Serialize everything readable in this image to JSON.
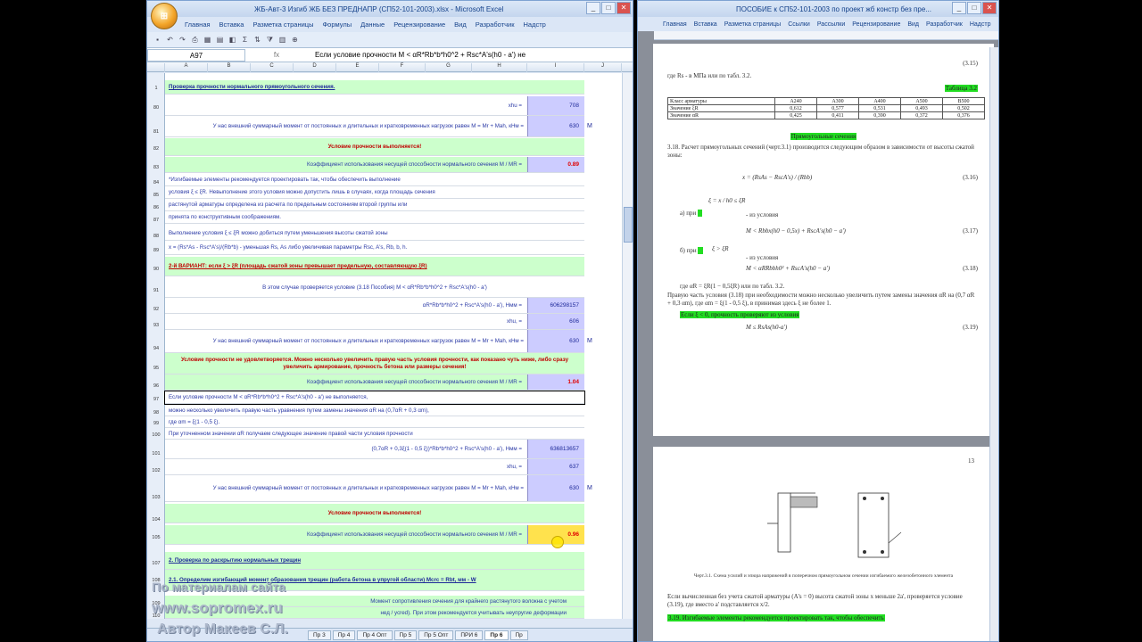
{
  "excel": {
    "title": "ЖБ-Авт-3 Изгиб ЖБ БЕЗ ПРЕДНАПР (СП52-101-2003).xlsx - Microsoft Excel",
    "ribbon_tabs": [
      "Главная",
      "Вставка",
      "Разметка страницы",
      "Формулы",
      "Данные",
      "Рецензирование",
      "Вид",
      "Разработчик",
      "Надстр"
    ],
    "name_box": "A97",
    "fx_label": "fx",
    "formula": "Если условие прочности M < αR*Rb*b*h0^2 + Rsc*A's(h0 - a')  не",
    "columns": [
      "A",
      "B",
      "C",
      "D",
      "E",
      "F",
      "G",
      "H",
      "I",
      "J"
    ],
    "rows": {
      "r1": {
        "num": "1",
        "text": "Проверка прочности нормального прямоугольного сечения."
      },
      "r80": {
        "num": "80",
        "label": "xhu =",
        "value": "708"
      },
      "r81": {
        "num": "81",
        "text": "У нас внешний суммарный момент от постоянных и длительных и кратковременных нагрузок равен M = Mr + Mah, кНм =",
        "value": "630",
        "unit": "M"
      },
      "r82": {
        "num": "82",
        "text": "Условие прочности выполняется!"
      },
      "r83": {
        "num": "83",
        "text": "Коэффициент использования несущей способности нормального сечения M / MR =",
        "value": "0.89"
      },
      "r84": {
        "num": "84",
        "text": "*Изгибаемые элементы рекомендуется проектировать так, чтобы обеспечить выполнение"
      },
      "r85": {
        "num": "85",
        "text": "условия ξ ≤ ξR. Невыполнение этого условия можно допустить лишь в случаях, когда площадь сечения"
      },
      "r86": {
        "num": "86",
        "text": "растянутой арматуры определена из расчета по предельным состояниям второй группы или"
      },
      "r87": {
        "num": "87",
        "text": "принята по конструктивным соображениям."
      },
      "r88": {
        "num": "88",
        "text": "Выполнение условия ξ ≤ ξR можно добиться путем уменьшения высоты сжатой зоны"
      },
      "r89": {
        "num": "89",
        "text": "x = (Rs*As - Rsc*A's)/(Rb*b) - уменьшая Rs, As либо увеличивая параметры Rsc, A's, Rb, b, h."
      },
      "r90": {
        "num": "90",
        "text": "2-й ВАРИАНТ:  если ξ > ξR (площадь сжатой зоны превышает предельную, составляющую ξR)"
      },
      "r91": {
        "num": "91",
        "text": "В этом случае проверяется условие (3.18 Пособия)  M < αR*Rb*b*h0^2 + Rsc*A's(h0 - a')"
      },
      "r92": {
        "num": "92",
        "label": "αR*Rb*b*h0^2 + Rsc*A's(h0 - a'), Hмм  =",
        "value": "606298157"
      },
      "r93": {
        "num": "93",
        "label": "xhu, =",
        "value": "606"
      },
      "r94": {
        "num": "94",
        "text": "У нас внешний суммарный момент от постоянных и длительных и кратковременных нагрузок равен M = Mr + Mah, кНм =",
        "value": "630",
        "unit": "M"
      },
      "r95": {
        "num": "95",
        "text": "Условие прочности не удовлетворяется. Можно несколько увеличить правую часть условия прочности, как показано чуть ниже, либо сразу увеличить армирование,  прочность бетона или размеры сечения!"
      },
      "r96": {
        "num": "96",
        "text": "Коэффициент использования несущей способности нормального сечения M / MR =",
        "value": "1.04"
      },
      "r97": {
        "num": "97",
        "text": "Если условие прочности M < αR*Rb*b*h0^2 + Rsc*A's(h0 - a')  не выполняется,"
      },
      "r98": {
        "num": "98",
        "text": "можно несколько увеличить правую часть уравнения путем замены значения αR на (0,7αR + 0,3 αm),"
      },
      "r99": {
        "num": "99",
        "text": "где αm = ξ(1 - 0,5 ξ)."
      },
      "r100": {
        "num": "100",
        "text": "При уточненном значении αR получаем следующее значение правой части условия прочности"
      },
      "r101": {
        "num": "101",
        "label": "(0,7αR + 0,3ξ(1 - 0,5 ξ))*Rb*b*h0^2 + Rsc*A's(h0 - a'), Hмм  =",
        "value": "636813657"
      },
      "r102": {
        "num": "102",
        "label": "xhu, =",
        "value": "637"
      },
      "r103": {
        "num": "103",
        "text": "У нас внешний суммарный момент от постоянных и длительных и кратковременных нагрузок равен M = Mr + Mah, кНм =",
        "value": "630",
        "unit": "M"
      },
      "r104": {
        "num": "104",
        "text": "Условие прочности выполняется!"
      },
      "r105": {
        "num": "105",
        "text": "Коэффициент использования несущей способности нормального сечения M / MR =",
        "value": "0.96"
      },
      "r107": {
        "num": "107",
        "text": "2. Проверка по раскрытию нормальных трещин"
      },
      "r108": {
        "num": "108",
        "text": "2.1. Определим изгибающий момент образования трещин (работа бетона в упругой области) Mcrc = Rbt, мм - W"
      },
      "r109": {
        "num": "109",
        "text": "Момент сопротивления сечения для крайнего растянутого волокна с учетом"
      },
      "r110": {
        "num": "110",
        "text": "нед / ycred). При этом рекомендуется учитывать неупругие деформации"
      }
    },
    "sheet_tabs": [
      "Пр 3",
      "Пр 4",
      "Пр 4 Опт",
      "Пр 5",
      "Пр 5 Опт",
      "ПРИ 6",
      "Пр 6",
      "Пр"
    ],
    "active_sheet": "Пр 6"
  },
  "watermark": {
    "line1": "По материалам сайта",
    "line2": "www.sopromex.ru",
    "line3": "Автор Макеев С.Л."
  },
  "word": {
    "title": "ПОСОБИЕ к СП52-101-2003 по проект жб констр без пре...",
    "ribbon_tabs": [
      "Главная",
      "Вставка",
      "Разметка страницы",
      "Ссылки",
      "Рассылки",
      "Рецензирование",
      "Вид",
      "Разработчик",
      "Надстр"
    ],
    "page1": {
      "eq_top_num": "(3.15)",
      "line_rs": "где Rs - в МПа или по табл. 3.2.",
      "table_title": "Таблица 3.2",
      "table_head": [
        "Класс арматуры",
        "A240",
        "A300",
        "A400",
        "A500",
        "B500"
      ],
      "table_row1": [
        "Значение ξR",
        "0,612",
        "0,577",
        "0,531",
        "0,493",
        "0,502"
      ],
      "table_row2": [
        "Значение αR",
        "0,425",
        "0,411",
        "0,390",
        "0,372",
        "0,376"
      ],
      "section": "Прямоугольные сечения",
      "p318": "3.18. Расчет прямоугольных сечений (черт.3.1) производится следующим образом в зависимости от высоты сжатой зоны:",
      "eq316": "x = (RsAs − RscA's) / (Rbb)",
      "eq316num": "(3.16)",
      "case_a": "а) при",
      "cond_a": "ξ = x / h0 ≤ ξR",
      "check_a": "- из условия",
      "eq317": "M < Rbbx(h0 − 0,5x) + RscA's(h0 − a')",
      "eq317num": "(3.17)",
      "case_b": "б) при",
      "cond_b": "ξ > ξR",
      "check_b": "- из условия",
      "eq318": "M < αRRbbh0² + RscA's(h0 − a')",
      "eq318num": "(3.18)",
      "where": "где αR = ξR(1 − 0,5ξR) или по табл. 3.2.",
      "note": "Правую часть условия (3.18) при необходимости можно несколько увеличить путем замены значения αR на (0,7 αR + 0,3 αm), где αm = ξ(1 - 0,5 ξ), в принимая здесь ξ не более 1.",
      "green_line": "Если ξ < 0, прочность проверяют из условия",
      "eq319": "M ≤ RsAs(h0-a')",
      "eq319num": "(3.19)"
    },
    "page2": {
      "page_num": "13",
      "caption": "Черт.3.1. Схема усилий и эпюра напряжений в поперечном прямоугольном сечении изгибаемого железобетонного элемента",
      "para": "Если вычисленная без учета сжатой арматуры (A's = 0) высота сжатой зоны x меньше 2a', проверяется условие (3.19), где вместо a' подставляется x/2.",
      "p319": "3.19. Изгибаемые элементы рекомендуется проектировать так, чтобы обеспечить"
    }
  }
}
